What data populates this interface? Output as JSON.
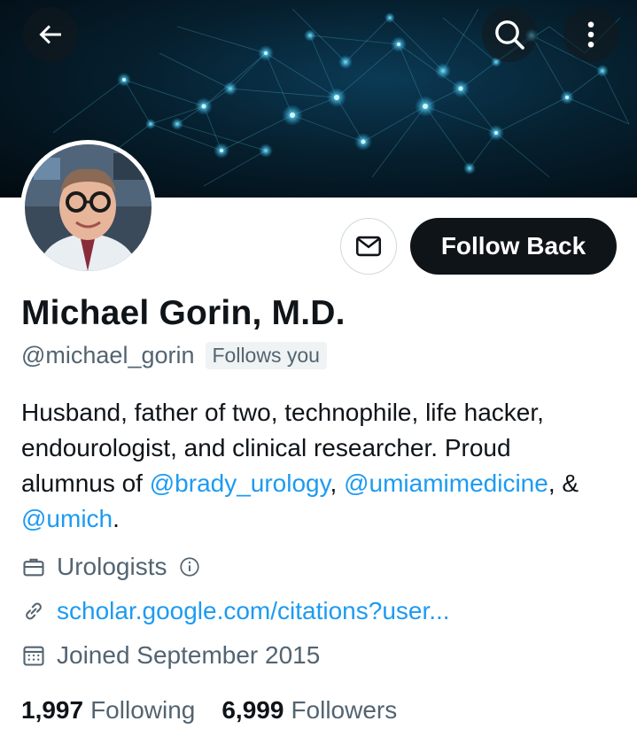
{
  "header": {
    "back_icon": "arrow-left-icon",
    "search_icon": "search-icon",
    "more_icon": "more-vertical-icon"
  },
  "profile": {
    "name": "Michael Gorin, M.D.",
    "handle": "@michael_gorin",
    "follows_you_badge": "Follows you",
    "follow_button_label": "Follow Back",
    "message_icon": "envelope-icon",
    "bio": {
      "line1": "Husband, father of two, technophile, life hacker,",
      "line2": "endourologist, and clinical researcher. Proud",
      "line3_prefix": "alumnus of ",
      "mention1": "@brady_urology",
      "sep1": ", ",
      "mention2": "@umiamimedicine",
      "sep2": ", &",
      "mention3": "@umich",
      "end": "."
    },
    "category": "Urologists",
    "category_icon": "briefcase-icon",
    "info_icon": "info-icon",
    "website": "scholar.google.com/citations?user...",
    "website_icon": "link-icon",
    "joined": "Joined September 2015",
    "joined_icon": "calendar-icon",
    "following_count": "1,997",
    "following_label": "Following",
    "followers_count": "6,999",
    "followers_label": "Followers"
  },
  "colors": {
    "accent": "#1d9bf0",
    "text_primary": "#0f1419",
    "text_secondary": "#536471",
    "button_dark": "#0f1419"
  }
}
